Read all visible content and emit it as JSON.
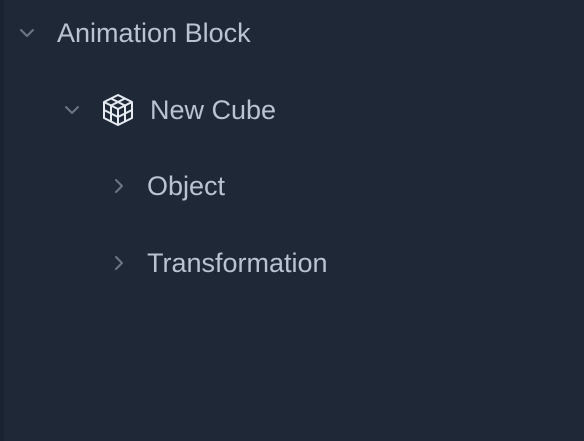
{
  "colors": {
    "background": "#1f2837",
    "text": "#b9c3d1",
    "chevron": "#6b7686",
    "icon": "#e6ebf2"
  },
  "tree": {
    "root": {
      "label": "Animation Block",
      "expanded": true,
      "icon": "chevron-down-icon"
    },
    "child": {
      "label": "New Cube",
      "expanded": true,
      "icon": "cube-icon",
      "children": [
        {
          "label": "Object",
          "expanded": false,
          "icon": "chevron-right-icon"
        },
        {
          "label": "Transformation",
          "expanded": false,
          "icon": "chevron-right-icon"
        }
      ]
    }
  }
}
